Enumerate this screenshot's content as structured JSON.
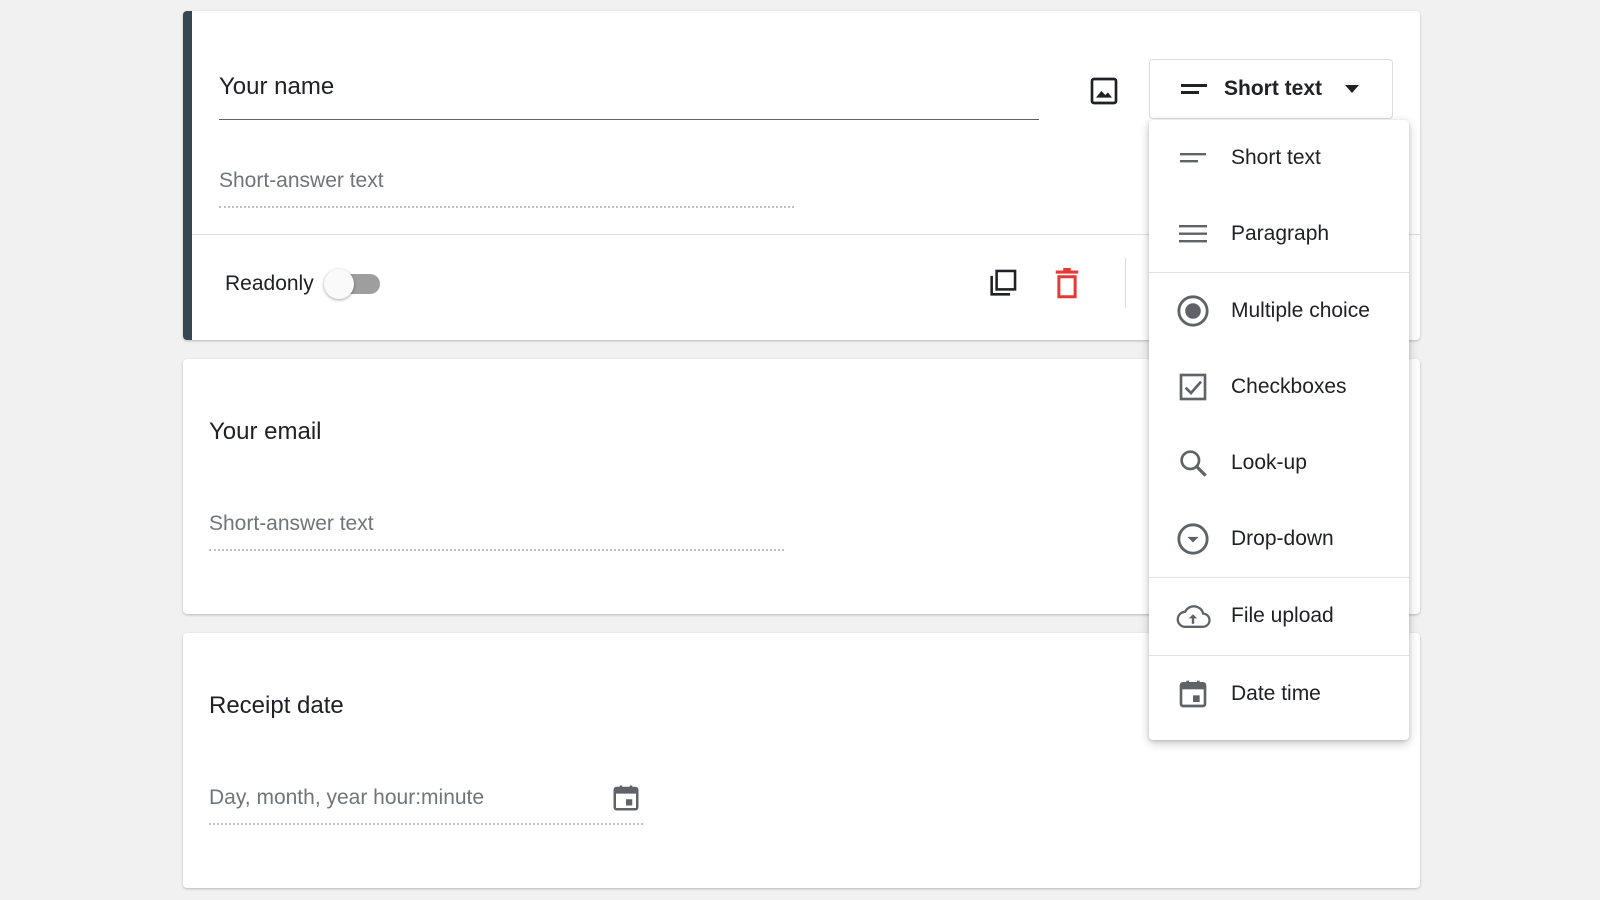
{
  "questions": {
    "name": {
      "title": "Your name",
      "placeholder": "Short-answer text",
      "type_label": "Short text",
      "readonly_label": "Readonly",
      "readonly_on": false
    },
    "email": {
      "title": "Your email",
      "placeholder": "Short-answer text"
    },
    "date": {
      "title": "Receipt date",
      "placeholder": "Day, month, year hour:minute"
    }
  },
  "type_menu": {
    "items": [
      {
        "label": "Short text",
        "icon": "short-text-icon"
      },
      {
        "label": "Paragraph",
        "icon": "paragraph-icon"
      },
      {
        "label": "Multiple choice",
        "icon": "radio-button-icon"
      },
      {
        "label": "Checkboxes",
        "icon": "checkbox-icon"
      },
      {
        "label": "Look-up",
        "icon": "search-icon"
      },
      {
        "label": "Drop-down",
        "icon": "dropdown-circle-icon"
      },
      {
        "label": "File upload",
        "icon": "cloud-upload-icon"
      },
      {
        "label": "Date time",
        "icon": "calendar-icon"
      }
    ]
  },
  "colors": {
    "active_bar": "#37474f",
    "delete_icon": "#e53935",
    "icon_gray": "#5f6368"
  }
}
